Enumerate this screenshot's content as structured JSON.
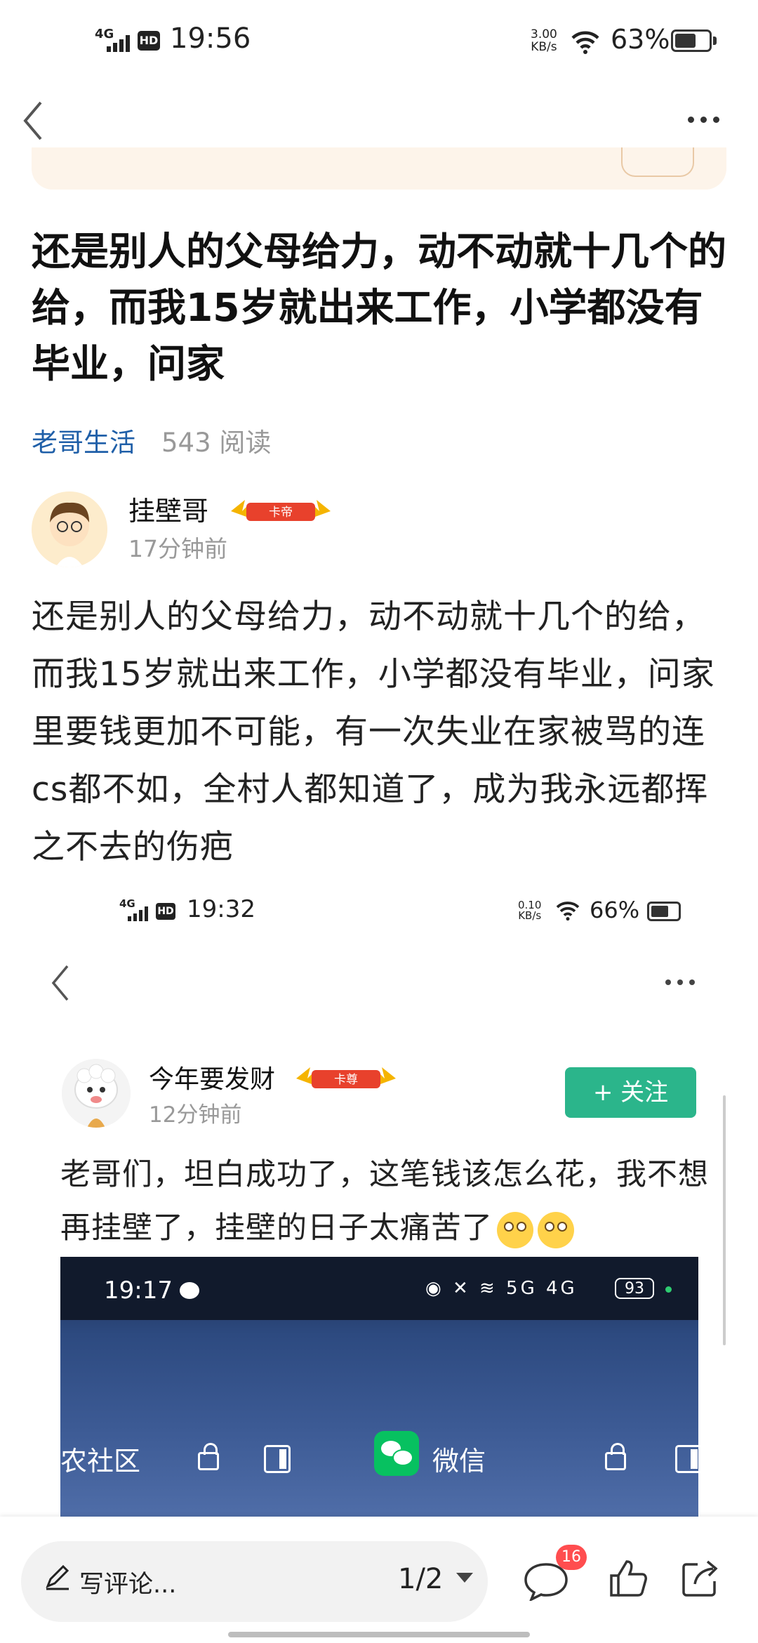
{
  "status_bar": {
    "network": "4G",
    "hd": "HD",
    "time": "19:56",
    "speed_value": "3.00",
    "speed_unit": "KB/s",
    "battery_pct": "63%",
    "battery_level": 0.63
  },
  "article": {
    "title": "还是别人的父母给力，动不动就十几个的给，而我15岁就出来工作，小学都没有毕业，问家",
    "source": "老哥生活",
    "views": "543 阅读",
    "author": {
      "name": "挂壁哥",
      "badge": "卡帝",
      "time": "17分钟前"
    },
    "body": "还是别人的父母给力，动不动就十几个的给，而我15岁就出来工作，小学都没有毕业，问家里要钱更加不可能，有一次失业在家被骂的连cs都不如，全村人都知道了，成为我永远都挥之不去的伤疤"
  },
  "embedded": {
    "status_bar": {
      "network": "4G",
      "hd": "HD",
      "time": "19:32",
      "speed_value": "0.10",
      "speed_unit": "KB/s",
      "battery_pct": "66%",
      "battery_level": 0.66
    },
    "author": {
      "name": "今年要发财",
      "badge": "卡尊",
      "time": "12分钟前"
    },
    "follow_label": "+ 关注",
    "post_text": "老哥们，坦白成功了，这笔钱该怎么花，我不想再挂壁了，挂壁的日子太痛苦了",
    "phone": {
      "time": "19:17",
      "status_icons": "◉ ✕ ≋ 5G 4G",
      "battery": "93",
      "label_left": "农社区",
      "label_wechat": "微信"
    }
  },
  "bottom_bar": {
    "comment_placeholder": "写评论...",
    "pager": "1/2",
    "comment_count": "16"
  },
  "colors": {
    "source_link": "#1f5fa8",
    "follow_button": "#2bb58b",
    "badge_red": "#ff4d4f",
    "banner": "#fdf4ea"
  }
}
